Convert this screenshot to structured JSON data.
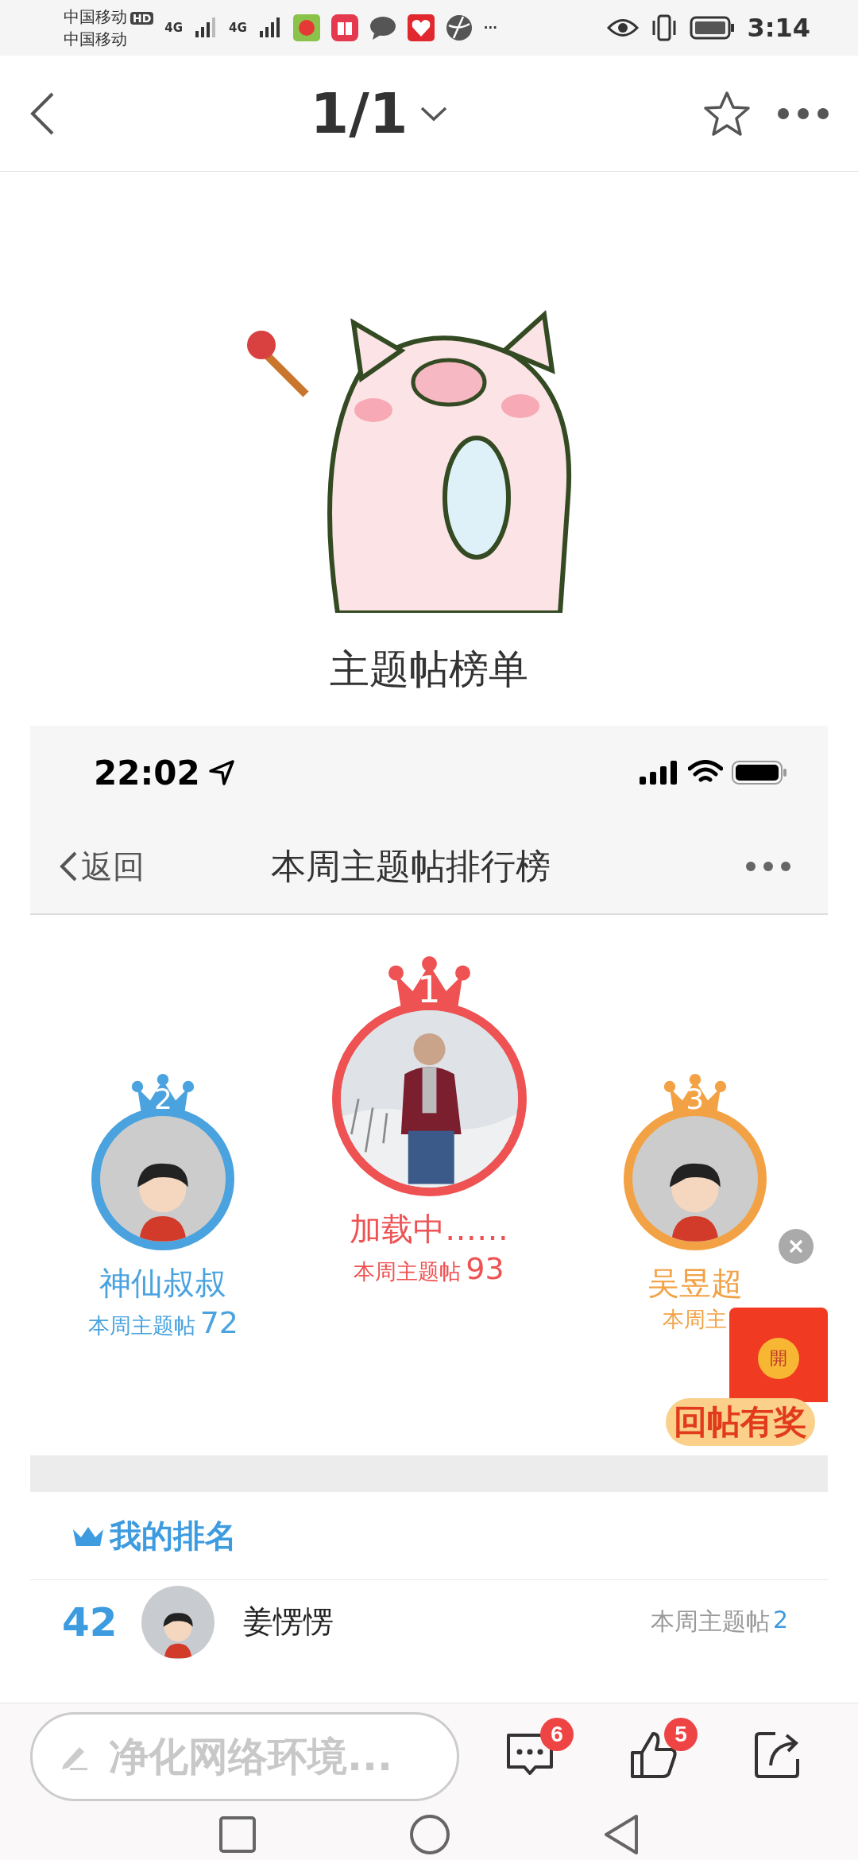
{
  "status_bar": {
    "carrier_1": "中国移动",
    "hd": "HD",
    "carrier_2": "中国移动",
    "network_1": "4G",
    "network_2": "4G",
    "more": "···",
    "time": "3:14"
  },
  "nav": {
    "page": "1/1"
  },
  "caption": "主题帖榜单",
  "embedded": {
    "status_bar": {
      "time": "22:02"
    },
    "nav": {
      "back": "返回",
      "title": "本周主题帖排行榜"
    },
    "podium": [
      {
        "rank": "2",
        "name": "神仙叔叔",
        "label": "本周主题帖",
        "count": "72",
        "color": "#4aa3df",
        "kind": "cartoon"
      },
      {
        "rank": "1",
        "name": "加载中……",
        "label": "本周主题帖",
        "count": "93",
        "color": "#ee5252"
      },
      {
        "rank": "3",
        "name": "吴昱超",
        "label": "本周主",
        "color": "#f2a244",
        "kind": "cartoon"
      }
    ],
    "my_rank": {
      "title": "我的排名",
      "rank": "42",
      "name": "姜愣愣",
      "label": "本周主题帖",
      "count": "2"
    }
  },
  "promo": {
    "badge": "開",
    "label": "回帖有奖"
  },
  "bottom_bar": {
    "placeholder": "净化网络环境...",
    "comments": "6",
    "likes": "5"
  }
}
